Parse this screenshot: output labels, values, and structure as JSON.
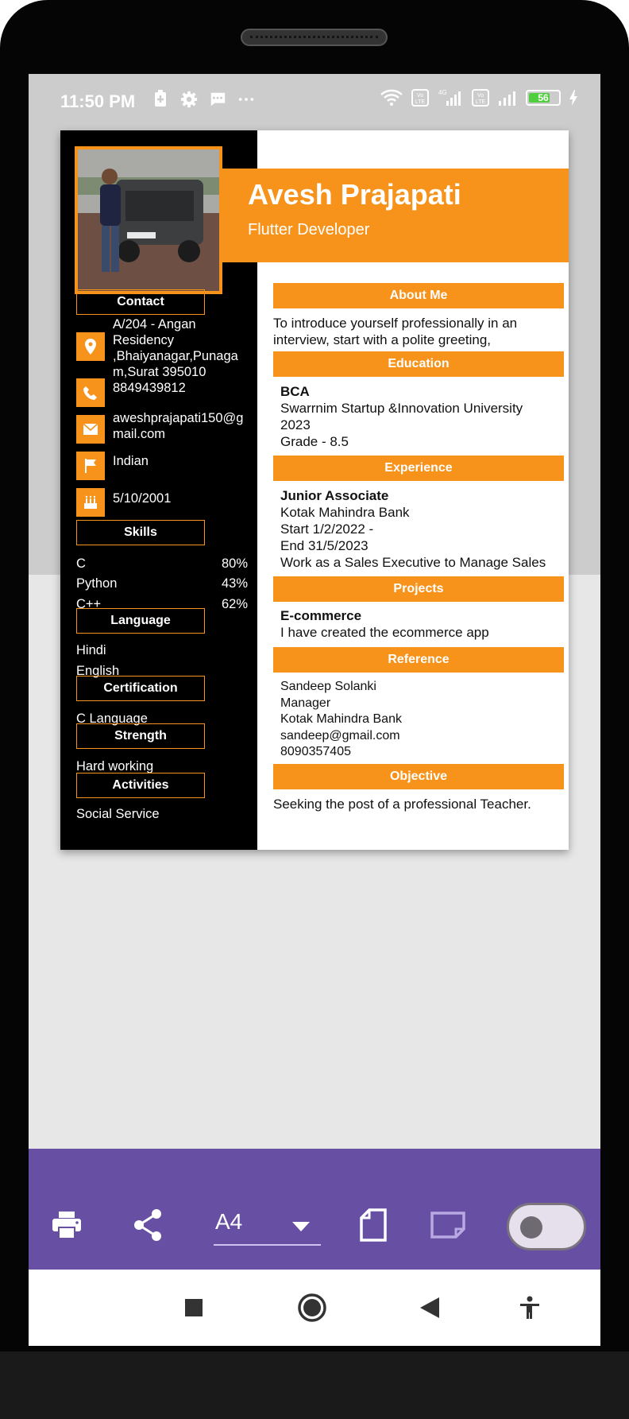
{
  "status_bar": {
    "time": "11:50 PM",
    "battery": "56"
  },
  "resume": {
    "name": "Avesh Prajapati",
    "role": "Flutter Developer",
    "contact": {
      "heading": "Contact",
      "address": "A/204 - Angan Residency ,Bhaiyanagar,Punagam,Surat 395010",
      "address_lines": [
        "A/204 - Angan",
        "Residency",
        ",Bhaiyanagar,Punaga",
        "m,Surat 395010"
      ],
      "phone": "8849439812",
      "email_lines": [
        "aweshprajapati150@g",
        "mail.com"
      ],
      "nationality": "Indian",
      "dob": "5/10/2001"
    },
    "skills": {
      "heading": "Skills",
      "items": [
        {
          "name": "C",
          "value": "80%"
        },
        {
          "name": "Python",
          "value": "43%"
        },
        {
          "name": "C++",
          "value": "62%"
        }
      ]
    },
    "language": {
      "heading": "Language",
      "items": [
        "Hindi",
        "English"
      ]
    },
    "certification": {
      "heading": "Certification",
      "items": [
        "C Language"
      ]
    },
    "strength": {
      "heading": "Strength",
      "items": [
        "Hard working"
      ]
    },
    "activities": {
      "heading": "Activities",
      "items": [
        "Social Service"
      ]
    },
    "about": {
      "heading": "About Me",
      "lines": [
        "To introduce yourself professionally in an",
        "interview, start with a polite greeting,"
      ]
    },
    "education": {
      "heading": "Education",
      "degree": "BCA",
      "institute": "Swarrnim Startup &Innovation University",
      "year": "2023",
      "grade": "Grade - 8.5"
    },
    "experience": {
      "heading": "Experience",
      "title": "Junior Associate",
      "company": "Kotak Mahindra Bank",
      "start": "Start 1/2/2022 -",
      "end": "End 31/5/2023",
      "description": "Work as a Sales Executive to Manage Sales"
    },
    "projects": {
      "heading": "Projects",
      "title": "E-commerce",
      "description": "I have created the ecommerce app"
    },
    "reference": {
      "heading": "Reference",
      "name": "Sandeep Solanki",
      "position": "Manager",
      "company": "Kotak Mahindra Bank",
      "email": "sandeep@gmail.com",
      "phone": "8090357405"
    },
    "objective": {
      "heading": "Objective",
      "text": "Seeking the post of a professional Teacher."
    }
  },
  "toolbar": {
    "page_format": "A4",
    "icons": [
      "print-icon",
      "share-icon",
      "dropdown-arrow-icon",
      "portrait-icon",
      "landscape-icon",
      "toggle-switch"
    ]
  },
  "navbar": {
    "icons": [
      "recents-icon",
      "home-icon",
      "back-icon",
      "accessibility-icon"
    ]
  },
  "colors": {
    "accent": "#f7921a",
    "toolbar": "#6750a4",
    "sidebar": "#000000"
  }
}
